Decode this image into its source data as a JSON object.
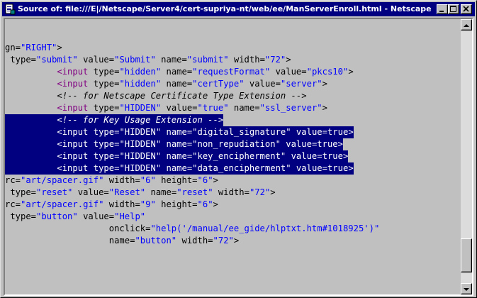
{
  "window": {
    "title": "Source of: file:///E|/Netscape/Server4/cert-supriya-nt/web/ee/ManServerEnroll.html - Netscape"
  },
  "colors": {
    "titlebar": "#000080",
    "selection": "#000080",
    "tag": "#800080",
    "value": "#0000ff",
    "window_face": "#c0c0c0"
  },
  "icons": {
    "app": "netscape-document-icon",
    "minimize": "minimize-icon",
    "maximize": "maximize-icon",
    "close": "close-icon",
    "scroll_up": "arrow-up-icon",
    "scroll_down": "arrow-down-icon"
  },
  "source": {
    "lines": [
      {
        "sel": false,
        "tokens": [
          [
            "a",
            "gn="
          ],
          [
            "v",
            "\"RIGHT\""
          ],
          [
            "a",
            ">"
          ]
        ]
      },
      {
        "sel": false,
        "tokens": [
          [
            "a",
            " type="
          ],
          [
            "v",
            "\"submit\""
          ],
          [
            "a",
            " value="
          ],
          [
            "v",
            "\"Submit\""
          ],
          [
            "a",
            " name="
          ],
          [
            "v",
            "\"submit\""
          ],
          [
            "a",
            " width="
          ],
          [
            "v",
            "\"72\""
          ],
          [
            "a",
            ">"
          ]
        ]
      },
      {
        "sel": false,
        "tokens": [
          [
            "a",
            "          "
          ],
          [
            "t",
            "<input"
          ],
          [
            "a",
            " type="
          ],
          [
            "v",
            "\"hidden\""
          ],
          [
            "a",
            " name="
          ],
          [
            "v",
            "\"requestFormat\""
          ],
          [
            "a",
            " value="
          ],
          [
            "v",
            "\"pkcs10\""
          ],
          [
            "a",
            ">"
          ]
        ]
      },
      {
        "sel": false,
        "tokens": [
          [
            "a",
            "          "
          ],
          [
            "t",
            "<input"
          ],
          [
            "a",
            " type="
          ],
          [
            "v",
            "\"hidden\""
          ],
          [
            "a",
            " name="
          ],
          [
            "v",
            "\"certType\""
          ],
          [
            "a",
            " value="
          ],
          [
            "v",
            "\"server\""
          ],
          [
            "a",
            ">"
          ]
        ]
      },
      {
        "sel": false,
        "tokens": [
          [
            "a",
            "          "
          ],
          [
            "c",
            "<!-- for Netscape Certificate Type Extension -->"
          ]
        ]
      },
      {
        "sel": false,
        "tokens": [
          [
            "a",
            "          "
          ],
          [
            "t",
            "<input"
          ],
          [
            "a",
            " type="
          ],
          [
            "v",
            "\"HIDDEN\""
          ],
          [
            "a",
            " value="
          ],
          [
            "v",
            "\"true\""
          ],
          [
            "a",
            " name="
          ],
          [
            "v",
            "\"ssl_server\""
          ],
          [
            "a",
            ">"
          ]
        ]
      },
      {
        "sel": true,
        "tokens": [
          [
            "a",
            "          "
          ],
          [
            "c",
            "<!-- for Key Usage Extension -->"
          ]
        ]
      },
      {
        "sel": true,
        "tokens": [
          [
            "a",
            "          "
          ],
          [
            "t",
            "<input"
          ],
          [
            "a",
            " type="
          ],
          [
            "v",
            "\"HIDDEN\""
          ],
          [
            "a",
            " name="
          ],
          [
            "v",
            "\"digital_signature\""
          ],
          [
            "a",
            " value="
          ],
          [
            "v",
            "true"
          ],
          [
            "a",
            ">"
          ]
        ]
      },
      {
        "sel": true,
        "tokens": [
          [
            "a",
            "          "
          ],
          [
            "t",
            "<input"
          ],
          [
            "a",
            " type="
          ],
          [
            "v",
            "\"HIDDEN\""
          ],
          [
            "a",
            " name="
          ],
          [
            "v",
            "\"non_repudiation\""
          ],
          [
            "a",
            " value="
          ],
          [
            "v",
            "true"
          ],
          [
            "a",
            ">"
          ]
        ]
      },
      {
        "sel": true,
        "tokens": [
          [
            "a",
            "          "
          ],
          [
            "t",
            "<input"
          ],
          [
            "a",
            " type="
          ],
          [
            "v",
            "\"HIDDEN\""
          ],
          [
            "a",
            " name="
          ],
          [
            "v",
            "\"key_encipherment\""
          ],
          [
            "a",
            " value="
          ],
          [
            "v",
            "true"
          ],
          [
            "a",
            ">"
          ]
        ]
      },
      {
        "sel": true,
        "tokens": [
          [
            "a",
            "          "
          ],
          [
            "t",
            "<input"
          ],
          [
            "a",
            " type="
          ],
          [
            "v",
            "\"HIDDEN\""
          ],
          [
            "a",
            " name="
          ],
          [
            "v",
            "\"data_encipherment\""
          ],
          [
            "a",
            " value="
          ],
          [
            "v",
            "true"
          ],
          [
            "a",
            ">"
          ]
        ]
      },
      {
        "sel": false,
        "tokens": [
          [
            "a",
            "rc="
          ],
          [
            "v",
            "\"art/spacer.gif\""
          ],
          [
            "a",
            " width="
          ],
          [
            "v",
            "\"6\""
          ],
          [
            "a",
            " height="
          ],
          [
            "v",
            "\"6\""
          ],
          [
            "a",
            ">"
          ]
        ]
      },
      {
        "sel": false,
        "tokens": [
          [
            "a",
            " type="
          ],
          [
            "v",
            "\"reset\""
          ],
          [
            "a",
            " value="
          ],
          [
            "v",
            "\"Reset\""
          ],
          [
            "a",
            " name="
          ],
          [
            "v",
            "\"reset\""
          ],
          [
            "a",
            " width="
          ],
          [
            "v",
            "\"72\""
          ],
          [
            "a",
            ">"
          ]
        ]
      },
      {
        "sel": false,
        "tokens": [
          [
            "a",
            "rc="
          ],
          [
            "v",
            "\"art/spacer.gif\""
          ],
          [
            "a",
            " width="
          ],
          [
            "v",
            "\"9\""
          ],
          [
            "a",
            " height="
          ],
          [
            "v",
            "\"6\""
          ],
          [
            "a",
            ">"
          ]
        ]
      },
      {
        "sel": false,
        "tokens": [
          [
            "a",
            " type="
          ],
          [
            "v",
            "\"button\""
          ],
          [
            "a",
            " value="
          ],
          [
            "v",
            "\"Help\""
          ]
        ]
      },
      {
        "sel": false,
        "tokens": [
          [
            "a",
            "                    onclick="
          ],
          [
            "v",
            "\"help('/manual/ee_gide/hlptxt.htm#1018925')\""
          ]
        ]
      },
      {
        "sel": false,
        "tokens": [
          [
            "a",
            "                    name="
          ],
          [
            "v",
            "\"button\""
          ],
          [
            "a",
            " width="
          ],
          [
            "v",
            "\"72\""
          ],
          [
            "a",
            ">"
          ]
        ]
      }
    ]
  },
  "scrollbar": {
    "position_fraction": 0.95
  }
}
